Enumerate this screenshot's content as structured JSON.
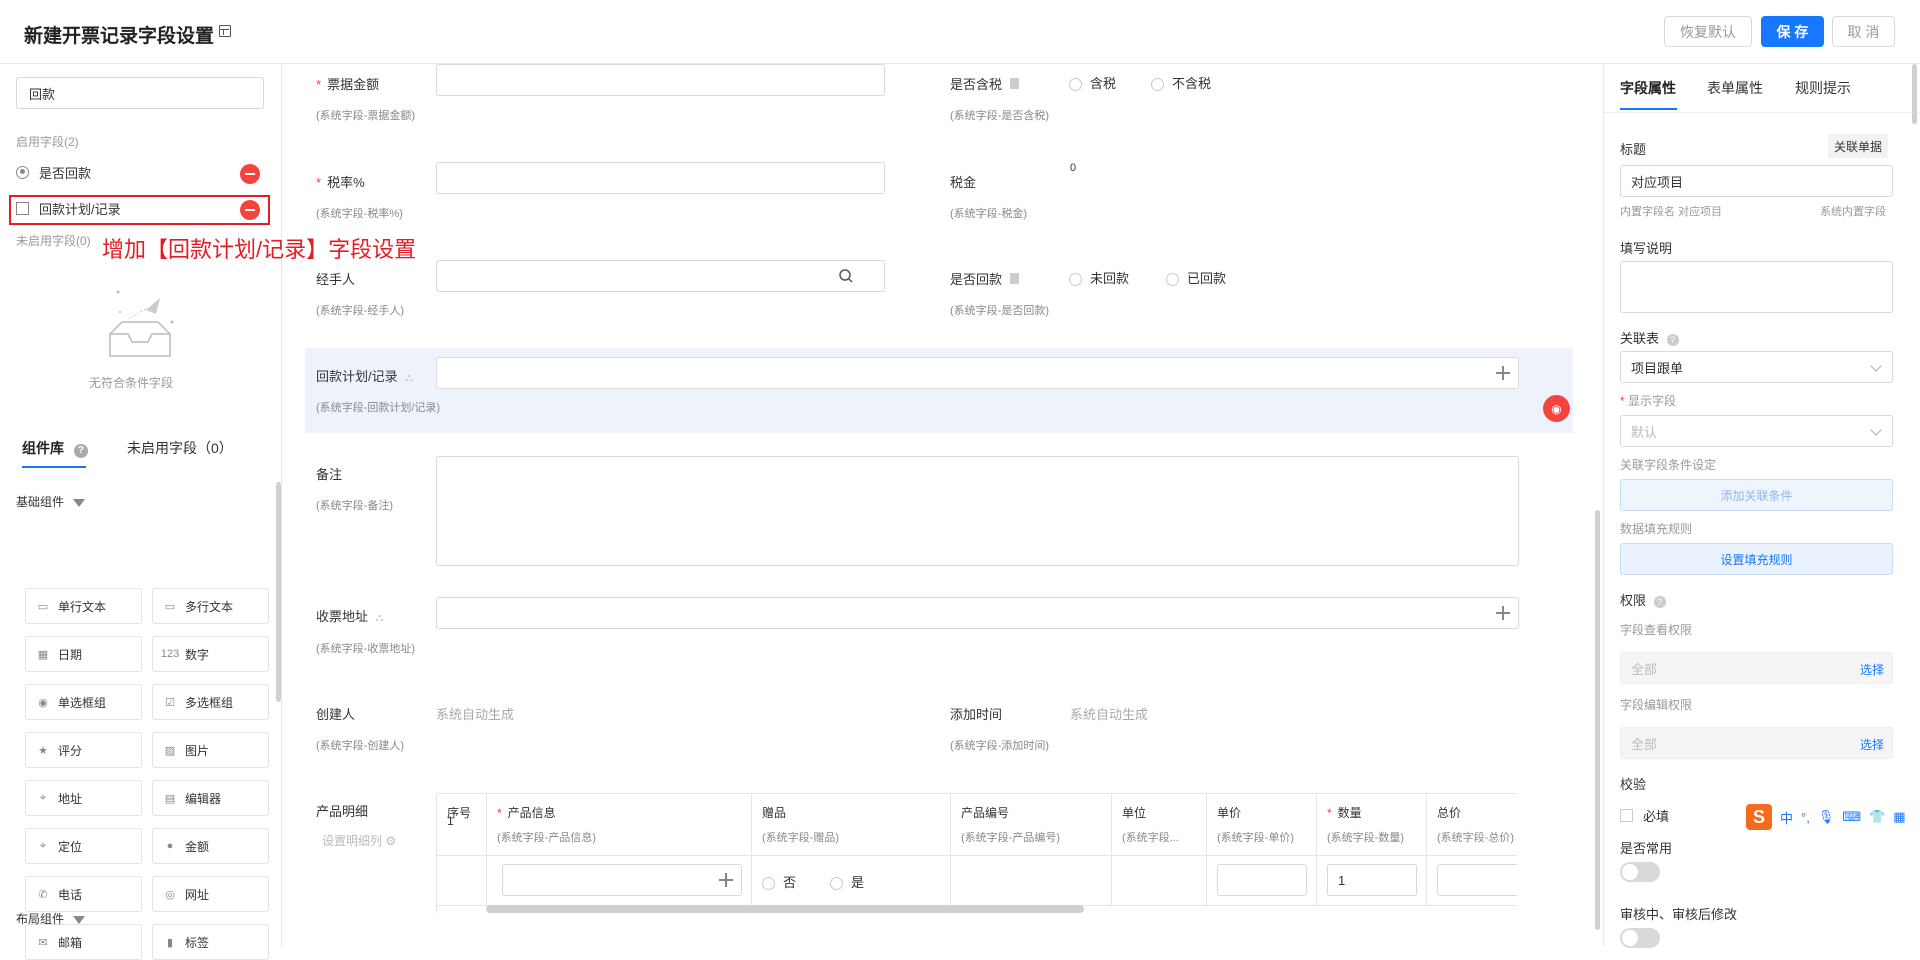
{
  "header": {
    "title": "新建开票记录字段设置",
    "restore_label": "恢复默认",
    "save_label": "保 存",
    "cancel_label": "取 消"
  },
  "left": {
    "search_value": "回款",
    "enabled_heading": "启用字段(2)",
    "enabled_items": [
      "是否回款",
      "回款计划/记录"
    ],
    "disabled_heading": "未启用字段(0)",
    "annotation": "增加【回款计划/记录】字段设置",
    "empty_text": "无符合条件字段",
    "tab_library": "组件库",
    "tab_disabled": "未启用字段（0）",
    "basic_heading": "基础组件",
    "layout_heading": "布局组件",
    "components": [
      "单行文本",
      "多行文本",
      "日期",
      "数字",
      "单选框组",
      "多选框组",
      "评分",
      "图片",
      "地址",
      "编辑器",
      "定位",
      "金额",
      "电话",
      "网址",
      "邮箱",
      "标签"
    ]
  },
  "main": {
    "amount_label": "票据金额",
    "amount_sub": "(系统字段-票据金额)",
    "tax_included_label": "是否含税",
    "tax_included_sub": "(系统字段-是否含税)",
    "tax_included_opt1": "含税",
    "tax_included_opt2": "不含税",
    "rate_label": "税率%",
    "rate_sub": "(系统字段-税率%)",
    "tax_label": "税金",
    "tax_value": "0",
    "tax_sub": "(系统字段-税金)",
    "handler_label": "经手人",
    "handler_sub": "(系统字段-经手人)",
    "paid_label": "是否回款",
    "paid_sub": "(系统字段-是否回款)",
    "paid_opt1": "未回款",
    "paid_opt2": "已回款",
    "plan_label": "回款计划/记录",
    "plan_sub": "(系统字段-回款计划/记录)",
    "remark_label": "备注",
    "remark_sub": "(系统字段-备注)",
    "address_label": "收票地址",
    "address_sub": "(系统字段-收票地址)",
    "creator_label": "创建人",
    "creator_value": "系统自动生成",
    "creator_sub": "(系统字段-创建人)",
    "addtime_label": "添加时间",
    "addtime_value": "系统自动生成",
    "addtime_sub": "(系统字段-添加时间)",
    "detail_label": "产品明细",
    "detail_setting": "设置明细列",
    "table": {
      "index_header": "序号",
      "columns": [
        {
          "name": "产品信息",
          "sub": "(系统字段-产品信息)",
          "required": true
        },
        {
          "name": "赠品",
          "sub": "(系统字段-赠品)",
          "required": false
        },
        {
          "name": "产品编号",
          "sub": "(系统字段-产品编号)",
          "required": false
        },
        {
          "name": "单位",
          "sub": "(系统字段...",
          "required": false
        },
        {
          "name": "单价",
          "sub": "(系统字段-单价)",
          "required": false
        },
        {
          "name": "数量",
          "sub": "(系统字段-数量)",
          "required": true
        },
        {
          "name": "总价",
          "sub": "(系统字段-总价)",
          "required": false
        }
      ],
      "row_index": "1",
      "gift_opt1": "否",
      "gift_opt2": "是",
      "qty_value": "1"
    }
  },
  "right": {
    "tab_field": "字段属性",
    "tab_form": "表单属性",
    "tab_rules": "规则提示",
    "title_label": "标题",
    "link_btn": "关联单据",
    "title_value": "对应项目",
    "builtin_name": "内置字段名 对应项目",
    "builtin_type": "系统内置字段",
    "desc_label": "填写说明",
    "assoc_label": "关联表",
    "assoc_value": "项目跟单",
    "display_label": "显示字段",
    "display_value": "默认",
    "cond_label": "关联字段条件设定",
    "cond_btn": "添加关联条件",
    "fill_label": "数据填充规则",
    "fill_btn": "设置填充规则",
    "perm_label": "权限",
    "view_perm_label": "字段查看权限",
    "view_perm_value": "全部",
    "view_perm_btn": "选择",
    "edit_perm_label": "字段编辑权限",
    "edit_perm_value": "全部",
    "edit_perm_btn": "选择",
    "check_label": "校验",
    "required_label": "必填",
    "common_label": "是否常用",
    "review_label": "审核中、审核后修改"
  },
  "ime": {
    "cn": "中"
  },
  "colors": {
    "primary": "#1677ff",
    "danger": "#f5443f",
    "annotation": "#e51c23",
    "highlight": "#eef3fb"
  }
}
